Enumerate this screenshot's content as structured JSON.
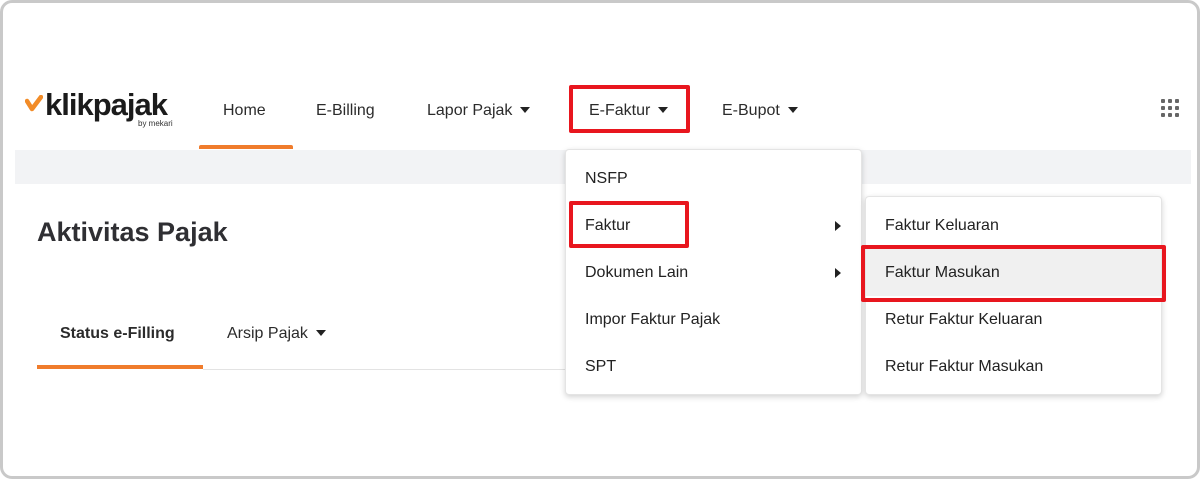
{
  "brand": {
    "name": "klikpajak",
    "sub": "by mekari",
    "accent_color": "#f07c2c",
    "check_color": "#f28c28"
  },
  "nav": {
    "home": "Home",
    "ebilling": "E-Billing",
    "lapor_pajak": "Lapor Pajak",
    "efaktur": "E-Faktur",
    "ebupot": "E-Bupot",
    "apps_icon": "grid-dots-icon"
  },
  "page": {
    "title": "Aktivitas Pajak"
  },
  "tabs": {
    "status": "Status e-Filling",
    "arsip": "Arsip Pajak"
  },
  "efaktur_menu": {
    "items": [
      "NSFP",
      "Faktur",
      "Dokumen Lain",
      "Impor Faktur Pajak",
      "SPT"
    ]
  },
  "faktur_submenu": {
    "items": [
      "Faktur Keluaran",
      "Faktur Masukan",
      "Retur Faktur Keluaran",
      "Retur Faktur Masukan"
    ]
  },
  "highlight_color": "#e8161e"
}
